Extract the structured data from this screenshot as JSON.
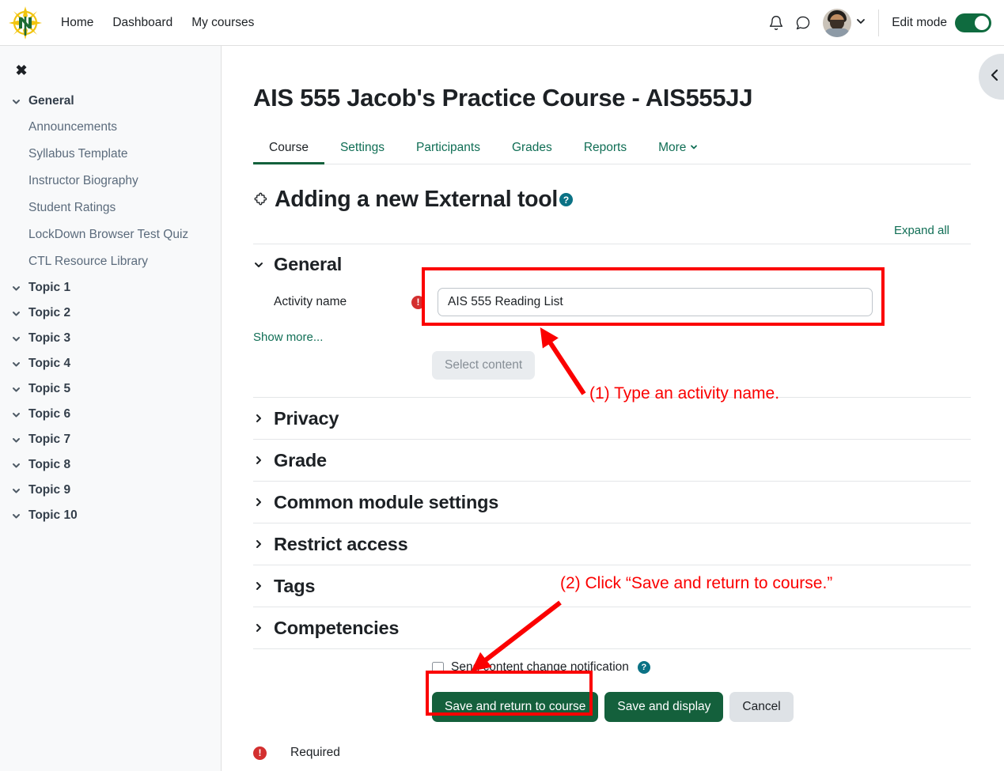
{
  "navbar": {
    "logo_alt": "Northern Michigan University",
    "links": [
      {
        "label": "Home"
      },
      {
        "label": "Dashboard"
      },
      {
        "label": "My courses"
      }
    ],
    "notifications_icon": "bell-icon",
    "messages_icon": "speech-bubble-icon",
    "edit_mode_label": "Edit mode",
    "edit_mode_on": true
  },
  "course_index": {
    "close_label": "✖",
    "sections": [
      {
        "label": "General",
        "expanded": true,
        "items": [
          {
            "label": "Announcements"
          },
          {
            "label": "Syllabus Template"
          },
          {
            "label": "Instructor Biography"
          },
          {
            "label": "Student Ratings"
          },
          {
            "label": "LockDown Browser Test Quiz"
          },
          {
            "label": "CTL Resource Library"
          }
        ]
      },
      {
        "label": "Topic 1",
        "expanded": true,
        "items": []
      },
      {
        "label": "Topic 2",
        "expanded": true,
        "items": []
      },
      {
        "label": "Topic 3",
        "expanded": true,
        "items": []
      },
      {
        "label": "Topic 4",
        "expanded": true,
        "items": []
      },
      {
        "label": "Topic 5",
        "expanded": true,
        "items": []
      },
      {
        "label": "Topic 6",
        "expanded": true,
        "items": []
      },
      {
        "label": "Topic 7",
        "expanded": true,
        "items": []
      },
      {
        "label": "Topic 8",
        "expanded": true,
        "items": []
      },
      {
        "label": "Topic 9",
        "expanded": true,
        "items": []
      },
      {
        "label": "Topic 10",
        "expanded": true,
        "items": []
      }
    ]
  },
  "right_drawer_toggle": {
    "icon": "chevron-left-icon"
  },
  "main": {
    "page_title": "AIS 555 Jacob's Practice Course - AIS555JJ",
    "tabs": [
      {
        "label": "Course",
        "active": true
      },
      {
        "label": "Settings",
        "active": false
      },
      {
        "label": "Participants",
        "active": false
      },
      {
        "label": "Grades",
        "active": false
      },
      {
        "label": "Reports",
        "active": false
      },
      {
        "label": "More",
        "active": false,
        "caret": "⌄"
      }
    ],
    "form_heading": "Adding a new External tool",
    "form_heading_icon": "puzzle-piece-icon",
    "form_heading_help": "?",
    "expand_all": "Expand all",
    "general_section": {
      "title": "General",
      "activity_name_label": "Activity name",
      "activity_name_value": "AIS 555 Reading List",
      "activity_name_placeholder": "",
      "required_marker": "!",
      "show_more": "Show more...",
      "select_content_button": "Select content"
    },
    "collapsed_sections": [
      {
        "label": "Privacy"
      },
      {
        "label": "Grade"
      },
      {
        "label": "Common module settings"
      },
      {
        "label": "Restrict access"
      },
      {
        "label": "Tags"
      },
      {
        "label": "Competencies"
      }
    ],
    "send_notification_label": "Send content change notification",
    "send_notification_checked": false,
    "send_notification_help": "?",
    "buttons": {
      "save_return": "Save and return to course",
      "save_display": "Save and display",
      "cancel": "Cancel"
    },
    "required_footer": "Required",
    "required_footer_marker": "!"
  },
  "annotations": {
    "step1": "(1) Type an activity name.",
    "step2": "(2) Click “Save and return to course.”",
    "color": "#fb0000"
  },
  "colors": {
    "brand_green": "#14603c",
    "link_green": "#106e55",
    "help_teal": "#0b7285",
    "required_red": "#d32f2f",
    "annotation_red": "#fb0000",
    "drawer_bg": "#f8f9fa"
  }
}
